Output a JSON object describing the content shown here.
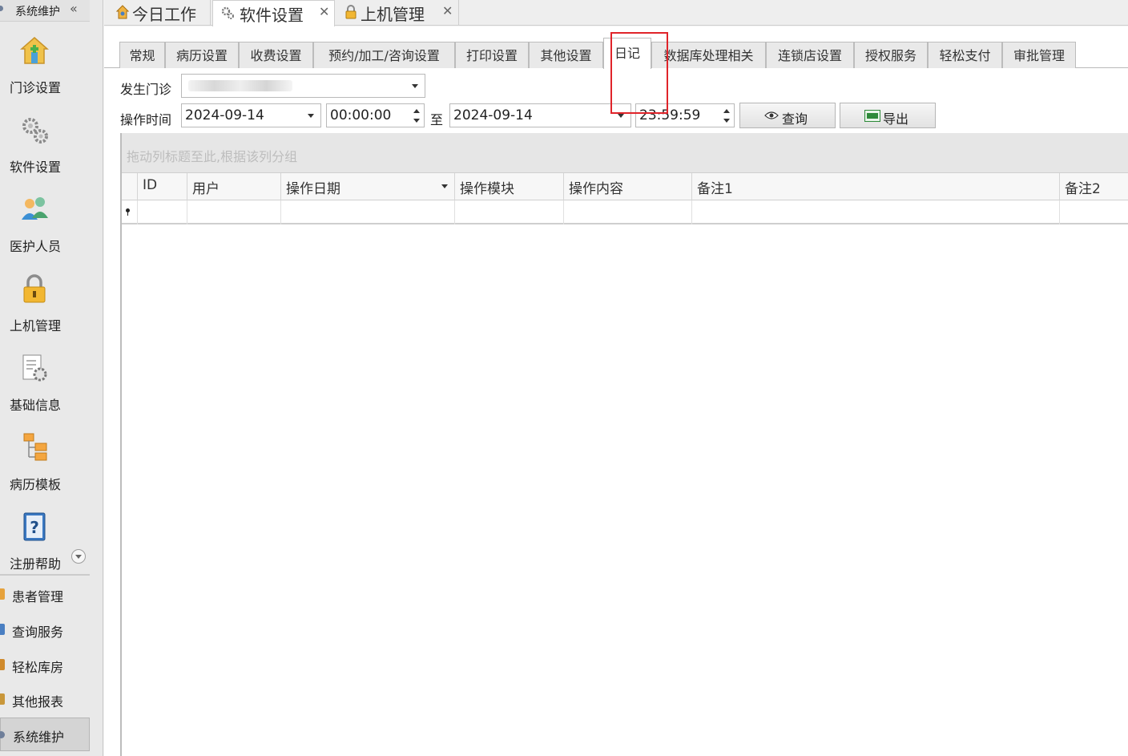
{
  "sidebar": {
    "header": "系统维护",
    "big_items": [
      {
        "label": "门诊设置",
        "icon": "clinic-home-icon"
      },
      {
        "label": "软件设置",
        "icon": "gears-icon"
      },
      {
        "label": "医护人员",
        "icon": "staff-people-icon"
      },
      {
        "label": "上机管理",
        "icon": "padlock-icon"
      },
      {
        "label": "基础信息",
        "icon": "document-gear-icon"
      },
      {
        "label": "病历模板",
        "icon": "tree-structure-icon"
      },
      {
        "label": "注册帮助",
        "icon": "help-book-icon"
      }
    ],
    "small_items": [
      {
        "label": "患者管理"
      },
      {
        "label": "查询服务"
      },
      {
        "label": "轻松库房"
      },
      {
        "label": "其他报表"
      },
      {
        "label": "系统维护"
      }
    ]
  },
  "doc_tabs": [
    {
      "label": "今日工作",
      "icon": "home-person-icon"
    },
    {
      "label": "软件设置",
      "icon": "gears-icon"
    },
    {
      "label": "上机管理",
      "icon": "padlock-icon"
    }
  ],
  "settings_tabs": [
    "常规",
    "病历设置",
    "收费设置",
    "预约/加工/咨询设置",
    "打印设置",
    "其他设置",
    "日记",
    "数据库处理相关",
    "连锁店设置",
    "授权服务",
    "轻松支付",
    "审批管理"
  ],
  "active_settings_tab": "日记",
  "filters": {
    "clinic_label": "发生门诊",
    "time_label": "操作时间",
    "start_date": "2024-09-14",
    "start_time": "00:00:00",
    "to_label": "至",
    "end_date": "2024-09-14",
    "end_time": "23:59:59"
  },
  "buttons": {
    "query": "查询",
    "export": "导出"
  },
  "grid": {
    "group_hint": "拖动列标题至此,根据该列分组",
    "columns": [
      "ID",
      "用户",
      "操作日期",
      "操作模块",
      "操作内容",
      "备注1",
      "备注2"
    ]
  },
  "colors": {
    "highlight": "#e0242a"
  }
}
